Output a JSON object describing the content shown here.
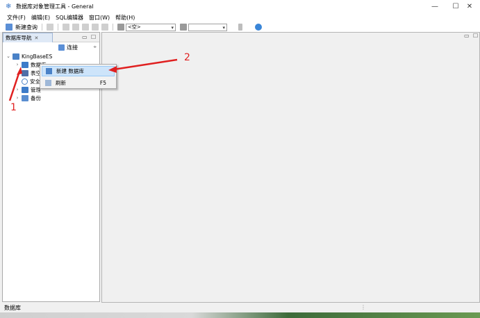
{
  "window": {
    "title": "数据库对象管理工具 - General",
    "controls": {
      "minimize": "—",
      "maximize": "☐",
      "close": "✕"
    }
  },
  "menubar": [
    {
      "label": "文件(F)"
    },
    {
      "label": "编辑(E)"
    },
    {
      "label": "SQL编辑器"
    },
    {
      "label": "窗口(W)"
    },
    {
      "label": "帮助(H)"
    }
  ],
  "toolbar": {
    "new_query": "新建查询",
    "combo1_value": "<空>",
    "combo2_value": ""
  },
  "navigator": {
    "tab_label": "数据库导航",
    "tab_close": "✕",
    "minimize": "▭",
    "maximize": "☐",
    "connect_label": "连接",
    "tree": {
      "root": "KingBaseES",
      "children": [
        {
          "label": "数据库",
          "icon": "database-icon"
        },
        {
          "label": "表空",
          "icon": "tablespace-icon"
        },
        {
          "label": "安全",
          "icon": "security-icon"
        },
        {
          "label": "管理",
          "icon": "admin-icon"
        },
        {
          "label": "备份",
          "icon": "backup-icon"
        }
      ]
    }
  },
  "editor": {
    "minimize": "▭",
    "maximize": "☐"
  },
  "context_menu": {
    "items": [
      {
        "label": "新建 数据库",
        "shortcut": ""
      },
      {
        "label": "刷新",
        "shortcut": "F5"
      }
    ]
  },
  "statusbar": {
    "text": "数据库"
  },
  "annotations": {
    "marker1": "1",
    "marker2": "2",
    "color": "#e02020"
  }
}
